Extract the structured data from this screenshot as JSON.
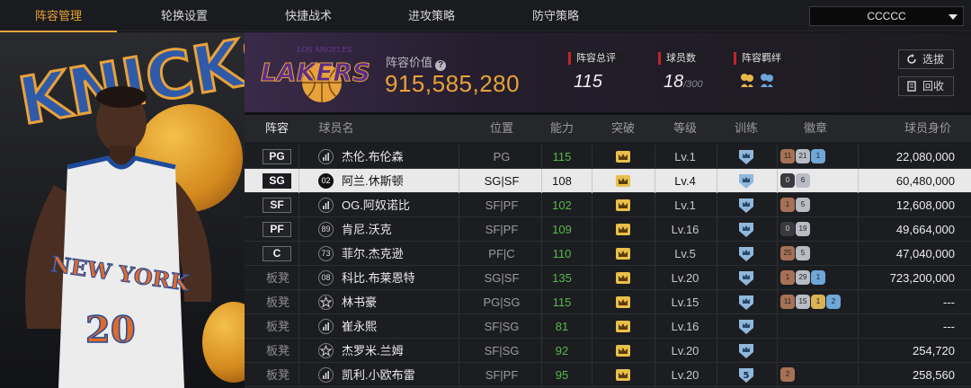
{
  "nav": {
    "tabs": [
      "阵容管理",
      "轮换设置",
      "快捷战术",
      "进攻策略",
      "防守策略"
    ],
    "active_index": 0,
    "team_select": "CCCCC"
  },
  "art": {
    "jersey_text": "NEW YORK",
    "jersey_number": "20",
    "team_word": "KNICKS"
  },
  "header": {
    "team_logo_text": "LAKERS",
    "team_logo_sub": "LOS ANGELES",
    "lineup_value_label": "阵容价值",
    "lineup_value": "915,585,280",
    "overall_label": "阵容总评",
    "overall_value": "115",
    "players_label": "球员数",
    "players_value": "18",
    "players_max": "/300",
    "chemistry_label": "阵容羁绊",
    "pick_button": "选拔",
    "recycle_button": "回收"
  },
  "table": {
    "headers": [
      "阵容",
      "球员名",
      "位置",
      "能力",
      "突破",
      "等级",
      "训练",
      "徽章",
      "球员身价"
    ],
    "rows": [
      {
        "slot": "PG",
        "is_bench": false,
        "num": "",
        "icon": "bars",
        "name": "杰伦.布伦森",
        "pos": "PG",
        "ability": "115",
        "level": "Lv.1",
        "train": "",
        "badges": [
          [
            "bronze",
            "11"
          ],
          [
            "silver",
            "21"
          ],
          [
            "blue",
            "1"
          ]
        ],
        "value": "22,080,000"
      },
      {
        "slot": "SG",
        "is_bench": false,
        "num": "02",
        "icon": "num",
        "name": "阿兰.休斯顿",
        "pos": "SG|SF",
        "ability": "108",
        "level": "Lv.4",
        "train": "",
        "badges": [
          [
            "dark",
            "0"
          ],
          [
            "silver",
            "6"
          ]
        ],
        "value": "60,480,000"
      },
      {
        "slot": "SF",
        "is_bench": false,
        "num": "",
        "icon": "bars",
        "name": "OG.阿奴诺比",
        "pos": "SF|PF",
        "ability": "102",
        "level": "Lv.1",
        "train": "",
        "badges": [
          [
            "bronze",
            "1"
          ],
          [
            "silver",
            "5"
          ]
        ],
        "value": "12,608,000"
      },
      {
        "slot": "PF",
        "is_bench": false,
        "num": "89",
        "icon": "num",
        "name": "肯尼.沃克",
        "pos": "SF|PF",
        "ability": "109",
        "level": "Lv.16",
        "train": "",
        "badges": [
          [
            "dark",
            "0"
          ],
          [
            "silver",
            "19"
          ]
        ],
        "value": "49,664,000"
      },
      {
        "slot": "C",
        "is_bench": false,
        "num": "73",
        "icon": "num",
        "name": "菲尔.杰克逊",
        "pos": "PF|C",
        "ability": "110",
        "level": "Lv.5",
        "train": "",
        "badges": [
          [
            "bronze",
            "25"
          ],
          [
            "silver",
            "5"
          ]
        ],
        "value": "47,040,000"
      },
      {
        "slot": "板凳",
        "is_bench": true,
        "num": "08",
        "icon": "num",
        "name": "科比.布莱恩特",
        "pos": "SG|SF",
        "ability": "135",
        "level": "Lv.20",
        "train": "",
        "badges": [
          [
            "bronze",
            "1"
          ],
          [
            "silver",
            "29"
          ],
          [
            "blue",
            "1"
          ]
        ],
        "value": "723,200,000"
      },
      {
        "slot": "板凳",
        "is_bench": true,
        "num": "",
        "icon": "star",
        "name": "林书豪",
        "pos": "PG|SG",
        "ability": "115",
        "level": "Lv.15",
        "train": "",
        "badges": [
          [
            "bronze",
            "11"
          ],
          [
            "silver",
            "15"
          ],
          [
            "gold",
            "1"
          ],
          [
            "blue",
            "2"
          ]
        ],
        "value": "---"
      },
      {
        "slot": "板凳",
        "is_bench": true,
        "num": "",
        "icon": "bars",
        "name": "崔永熙",
        "pos": "SF|SG",
        "ability": "81",
        "level": "Lv.16",
        "train": "",
        "badges": [],
        "value": "---"
      },
      {
        "slot": "板凳",
        "is_bench": true,
        "num": "",
        "icon": "star",
        "name": "杰罗米.兰姆",
        "pos": "SF|SG",
        "ability": "92",
        "level": "Lv.20",
        "train": "",
        "badges": [],
        "value": "254,720"
      },
      {
        "slot": "板凳",
        "is_bench": true,
        "num": "",
        "icon": "bars",
        "name": "凯利.小欧布雷",
        "pos": "SF|PF",
        "ability": "95",
        "level": "Lv.20",
        "train": "5",
        "badges": [
          [
            "bronze",
            "2"
          ]
        ],
        "value": "258,560"
      }
    ],
    "selected_index": 1
  },
  "colors": {
    "accent": "#e8a23a",
    "ability_green": "#58b84a",
    "label_red": "#c3242a",
    "selected_row": "#e9e9ea"
  }
}
